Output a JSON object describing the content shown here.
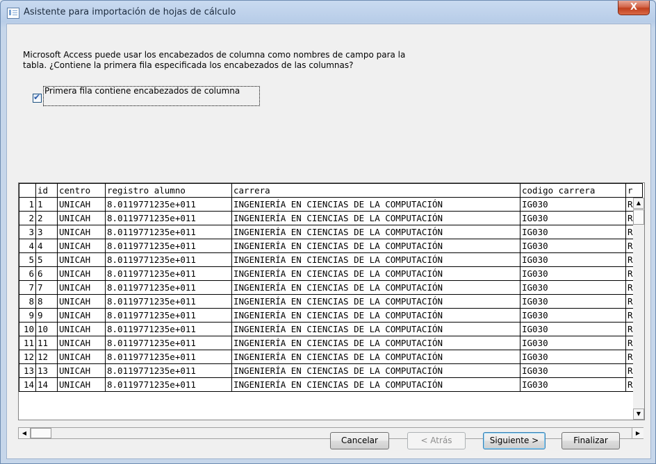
{
  "window": {
    "title": "Asistente para importación de hojas de cálculo",
    "close_glyph": "X"
  },
  "description": {
    "line1": "Microsoft Access puede usar los encabezados de columna como nombres de campo para la",
    "line2": "tabla. ¿Contiene la primera fila especificada los encabezados de las columnas?"
  },
  "checkbox": {
    "label": "Primera fila contiene encabezados de columna",
    "checked": true
  },
  "table": {
    "columns": [
      "id",
      "centro",
      "registro alumno",
      "carrera",
      "codigo carrera",
      "r"
    ],
    "rows": [
      [
        "1",
        "1",
        "UNICAH",
        "8.0119771235e+011",
        "INGENIERÍA EN CIENCIAS DE LA COMPUTACIÓN",
        "IG030",
        "R"
      ],
      [
        "2",
        "2",
        "UNICAH",
        "8.0119771235e+011",
        "INGENIERÍA EN CIENCIAS DE LA COMPUTACIÓN",
        "IG030",
        "R"
      ],
      [
        "3",
        "3",
        "UNICAH",
        "8.0119771235e+011",
        "INGENIERÍA EN CIENCIAS DE LA COMPUTACIÓN",
        "IG030",
        "R"
      ],
      [
        "4",
        "4",
        "UNICAH",
        "8.0119771235e+011",
        "INGENIERÍA EN CIENCIAS DE LA COMPUTACIÓN",
        "IG030",
        "R"
      ],
      [
        "5",
        "5",
        "UNICAH",
        "8.0119771235e+011",
        "INGENIERÍA EN CIENCIAS DE LA COMPUTACIÓN",
        "IG030",
        "R"
      ],
      [
        "6",
        "6",
        "UNICAH",
        "8.0119771235e+011",
        "INGENIERÍA EN CIENCIAS DE LA COMPUTACIÓN",
        "IG030",
        "R"
      ],
      [
        "7",
        "7",
        "UNICAH",
        "8.0119771235e+011",
        "INGENIERÍA EN CIENCIAS DE LA COMPUTACIÓN",
        "IG030",
        "R"
      ],
      [
        "8",
        "8",
        "UNICAH",
        "8.0119771235e+011",
        "INGENIERÍA EN CIENCIAS DE LA COMPUTACIÓN",
        "IG030",
        "R"
      ],
      [
        "9",
        "9",
        "UNICAH",
        "8.0119771235e+011",
        "INGENIERÍA EN CIENCIAS DE LA COMPUTACIÓN",
        "IG030",
        "R"
      ],
      [
        "10",
        "10",
        "UNICAH",
        "8.0119771235e+011",
        "INGENIERÍA EN CIENCIAS DE LA COMPUTACIÓN",
        "IG030",
        "R"
      ],
      [
        "11",
        "11",
        "UNICAH",
        "8.0119771235e+011",
        "INGENIERÍA EN CIENCIAS DE LA COMPUTACIÓN",
        "IG030",
        "R"
      ],
      [
        "12",
        "12",
        "UNICAH",
        "8.0119771235e+011",
        "INGENIERÍA EN CIENCIAS DE LA COMPUTACIÓN",
        "IG030",
        "R"
      ],
      [
        "13",
        "13",
        "UNICAH",
        "8.0119771235e+011",
        "INGENIERÍA EN CIENCIAS DE LA COMPUTACIÓN",
        "IG030",
        "R"
      ],
      [
        "14",
        "14",
        "UNICAH",
        "8.0119771235e+011",
        "INGENIERÍA EN CIENCIAS DE LA COMPUTACIÓN",
        "IG030",
        "R"
      ]
    ]
  },
  "buttons": {
    "cancel": "Cancelar",
    "back": "< Atrás",
    "next": "Siguiente >",
    "finish": "Finalizar"
  },
  "icons": {
    "app": "datasheet-icon",
    "check": "checkmark-icon",
    "scroll_up": "arrow-up-icon",
    "scroll_down": "arrow-down-icon",
    "scroll_left": "arrow-left-icon",
    "scroll_right": "arrow-right-icon"
  },
  "colors": {
    "title_bar": "#c9daf0",
    "close_button": "#c1401d",
    "dialog_bg": "#f0f0f0"
  }
}
